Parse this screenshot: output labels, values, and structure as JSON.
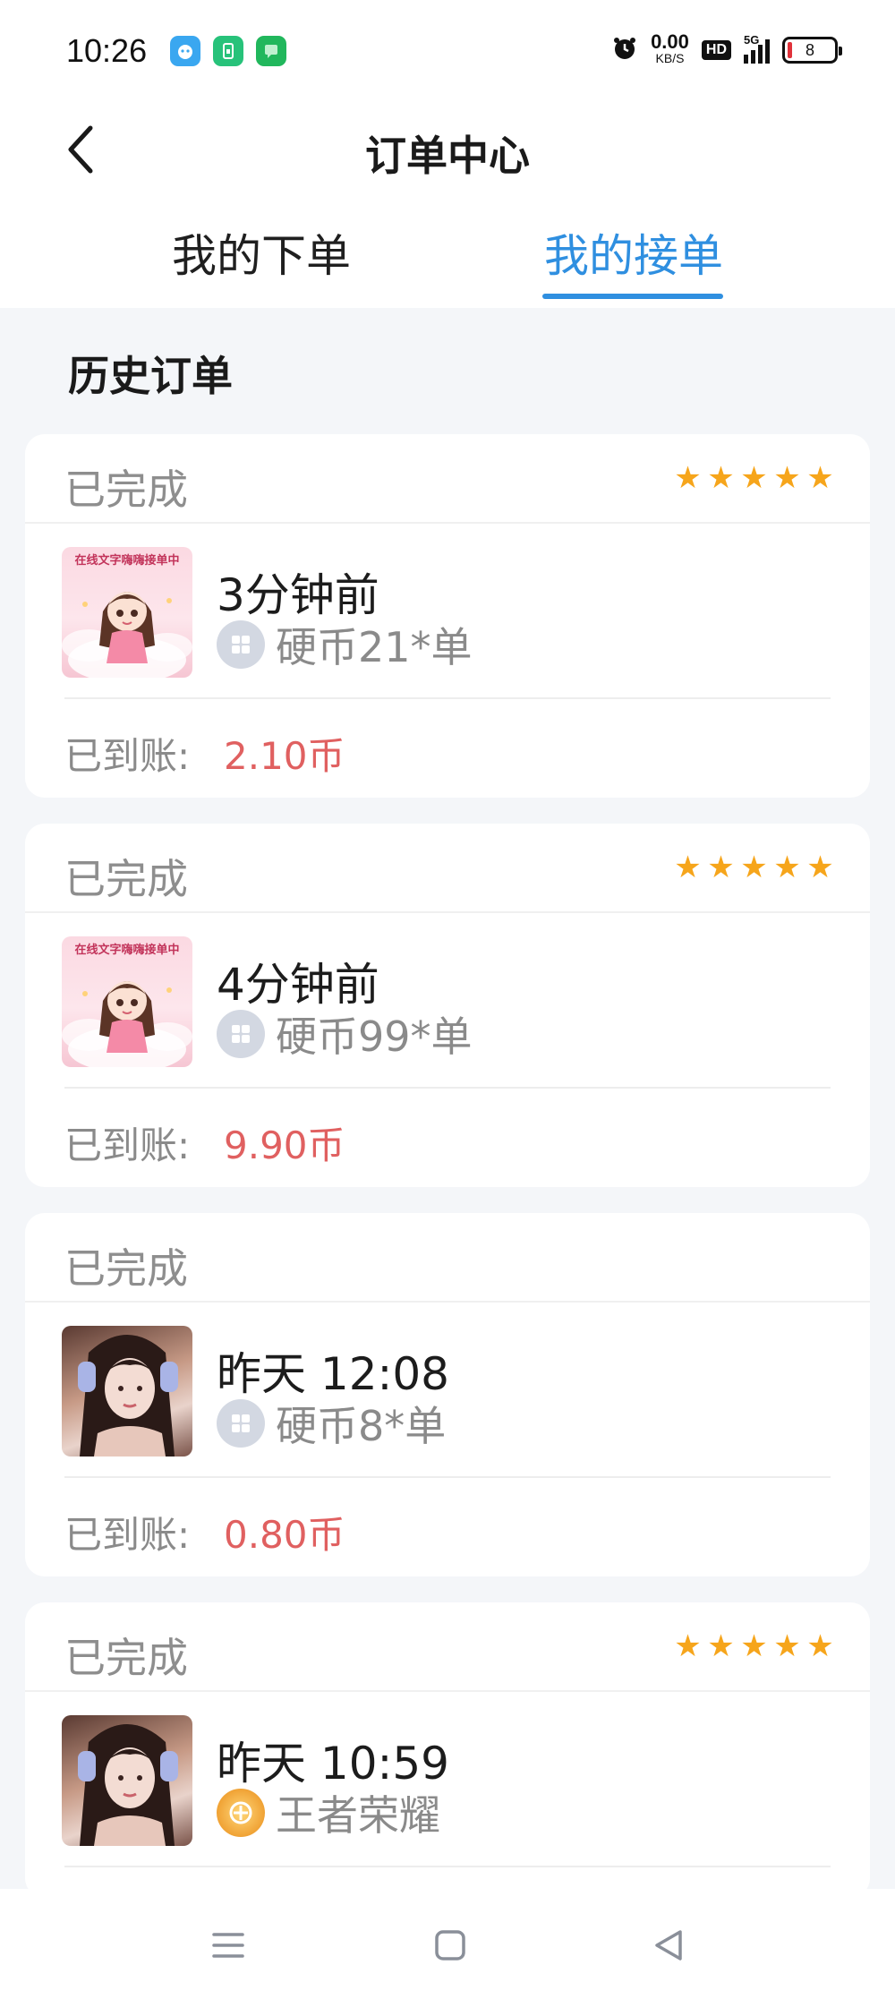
{
  "status_bar": {
    "time": "10:26",
    "speed_value": "0.00",
    "speed_unit": "KB/S",
    "hd": "HD",
    "network": "5G",
    "battery": "8",
    "battery_level_percent": 8,
    "app_icons": [
      "app-bot-icon",
      "app-green-icon",
      "message-app-icon"
    ]
  },
  "header": {
    "title": "订单中心",
    "back_icon": "back-arrow-icon"
  },
  "tabs": [
    {
      "label": "我的下单",
      "active": false
    },
    {
      "label": "我的接单",
      "active": true
    }
  ],
  "section": {
    "title": "历史订单"
  },
  "orders": [
    {
      "status": "已完成",
      "rating": 5,
      "thumb": "anime-girl",
      "thumb_caption": "在线文字嗨嗨接单中",
      "time": "3分钟前",
      "game_icon": "coin-grid-icon",
      "game": "硬币21*单",
      "paid_label": "已到账:",
      "paid_value": "2.10币"
    },
    {
      "status": "已完成",
      "rating": 5,
      "thumb": "anime-girl",
      "thumb_caption": "在线文字嗨嗨接单中",
      "time": "4分钟前",
      "game_icon": "coin-grid-icon",
      "game": "硬币99*单",
      "paid_label": "已到账:",
      "paid_value": "9.90币"
    },
    {
      "status": "已完成",
      "rating": 0,
      "thumb": "photo-girl",
      "time": "昨天 12:08",
      "game_icon": "coin-grid-icon",
      "game": "硬币8*单",
      "paid_label": "已到账:",
      "paid_value": "0.80币"
    },
    {
      "status": "已完成",
      "rating": 5,
      "thumb": "photo-girl",
      "time": "昨天 10:59",
      "game_icon": "honor-of-kings-icon",
      "game": "王者荣耀"
    }
  ],
  "colors": {
    "accent": "#2f8fe0",
    "star": "#f6a51b",
    "paid": "#e06060",
    "muted": "#8a8a8a",
    "background": "#f4f6f9"
  },
  "nav_bar": {
    "icons": [
      "menu-icon",
      "home-square-icon",
      "back-triangle-icon"
    ]
  }
}
